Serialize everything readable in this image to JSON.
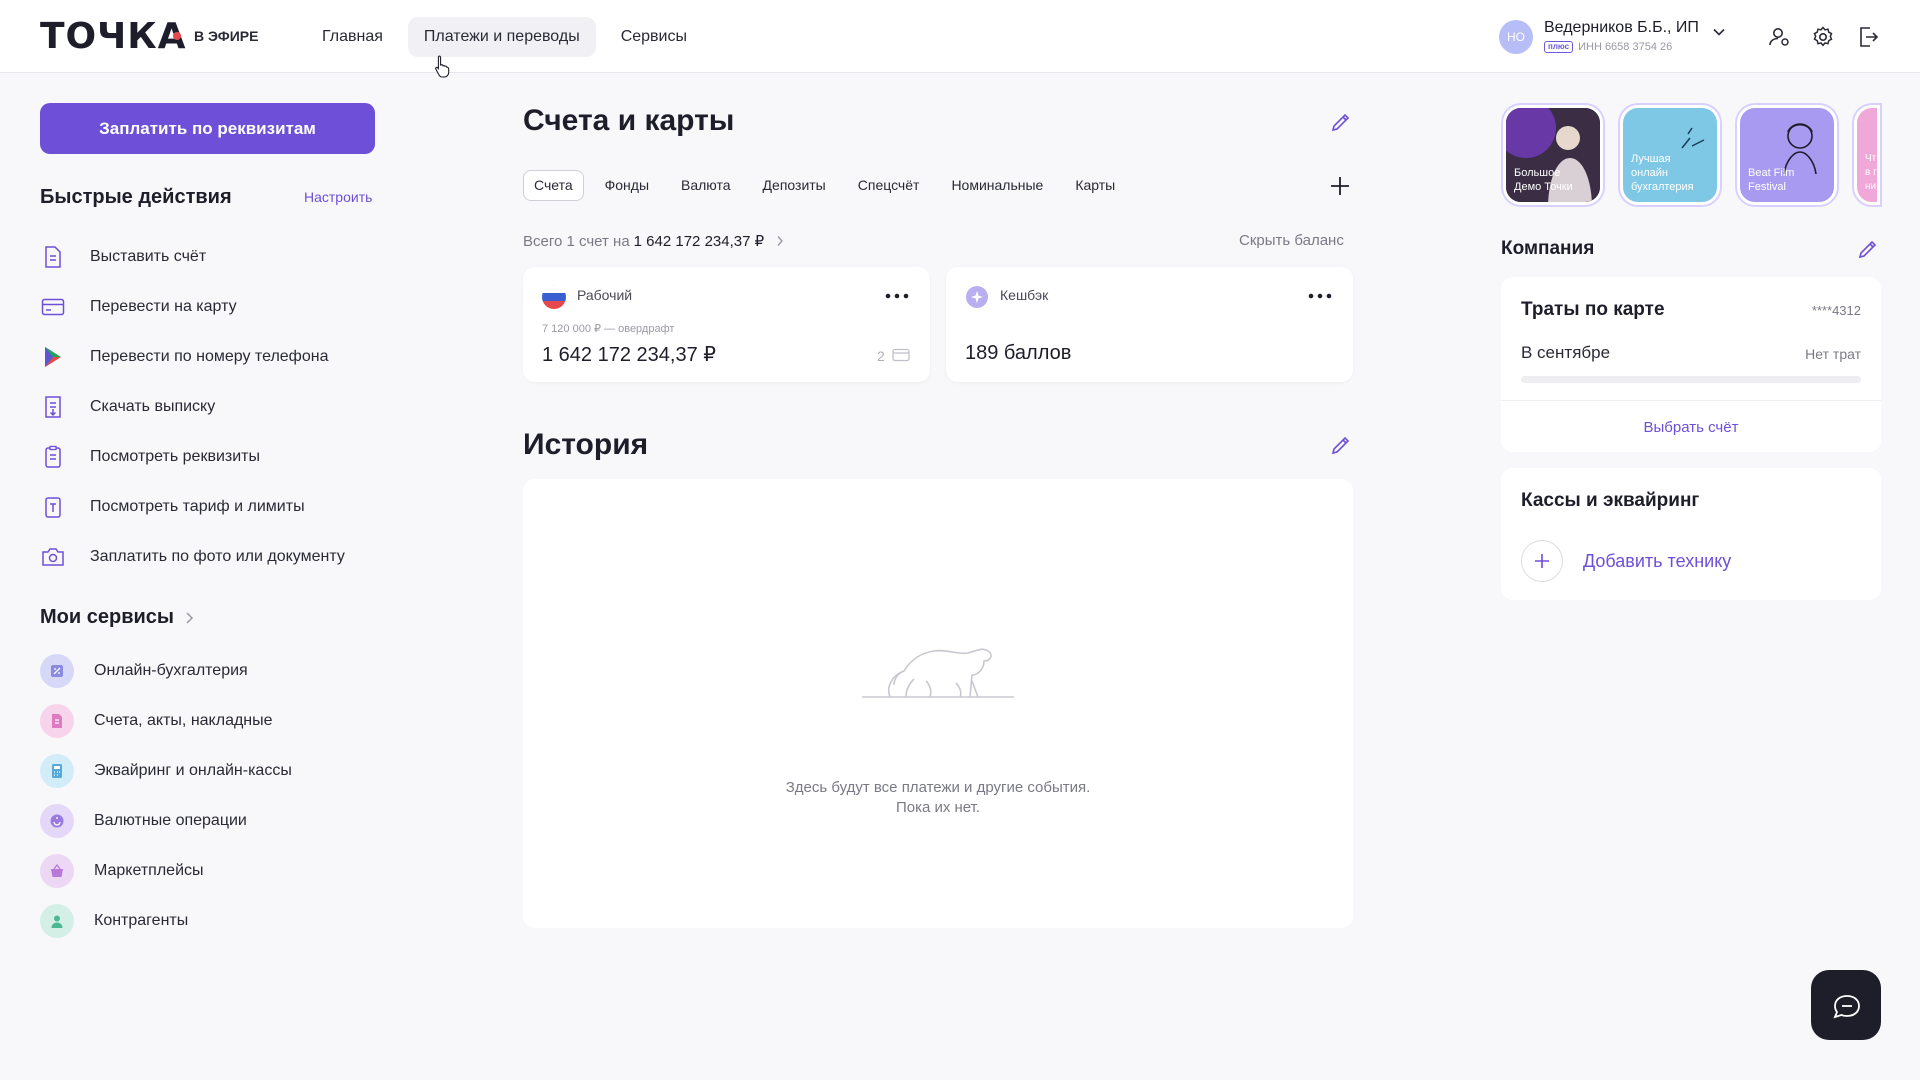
{
  "header": {
    "logo": "ТОЧКА",
    "live": "В ЭФИРЕ",
    "nav": [
      {
        "label": "Главная",
        "active": false
      },
      {
        "label": "Платежи и переводы",
        "active": true
      },
      {
        "label": "Сервисы",
        "active": false
      }
    ],
    "user": {
      "initials": "НО",
      "name": "Ведерников Б.Б., ИП",
      "badge": "плюс",
      "inn": "ИНН 6658 3754 26"
    }
  },
  "left": {
    "pay_button": "Заплатить по реквизитам",
    "quick_title": "Быстрые действия",
    "quick_setup": "Настроить",
    "quick_actions": [
      {
        "label": "Выставить счёт",
        "icon": "invoice-icon"
      },
      {
        "label": "Перевести на карту",
        "icon": "card-icon"
      },
      {
        "label": "Перевести по номеру телефона",
        "icon": "sbp-icon"
      },
      {
        "label": "Скачать выписку",
        "icon": "download-statement-icon"
      },
      {
        "label": "Посмотреть реквизиты",
        "icon": "requisites-icon"
      },
      {
        "label": "Посмотреть тариф и лимиты",
        "icon": "tariff-icon"
      },
      {
        "label": "Заплатить по фото или документу",
        "icon": "camera-icon"
      }
    ],
    "services_title": "Мои сервисы",
    "services": [
      {
        "label": "Онлайн-бухгалтерия",
        "color": "#b8b8f0"
      },
      {
        "label": "Счета, акты, накладные",
        "color": "#f0a8d8"
      },
      {
        "label": "Эквайринг и онлайн-кассы",
        "color": "#a8d8f0"
      },
      {
        "label": "Валютные операции",
        "color": "#c8b0f0"
      },
      {
        "label": "Маркетплейсы",
        "color": "#d8b0e8"
      },
      {
        "label": "Контрагенты",
        "color": "#a8e0d0"
      }
    ]
  },
  "main": {
    "accounts_title": "Счета и карты",
    "tabs": [
      {
        "label": "Счета",
        "active": true
      },
      {
        "label": "Фонды",
        "active": false
      },
      {
        "label": "Валюта",
        "active": false
      },
      {
        "label": "Депозиты",
        "active": false
      },
      {
        "label": "Спецсчёт",
        "active": false
      },
      {
        "label": "Номинальные",
        "active": false
      },
      {
        "label": "Карты",
        "active": false
      }
    ],
    "total_prefix": "Всего 1 счет на",
    "total_amount": "1 642 172 234,37 ₽",
    "hide_balance": "Скрыть баланс",
    "account": {
      "name": "Рабочий",
      "overdraft": "7 120 000 ₽ — овердрафт",
      "balance": "1 642 172 234,37 ₽",
      "cards_count": "2"
    },
    "cashback": {
      "name": "Кешбэк",
      "points": "189 баллов"
    },
    "history_title": "История",
    "history_empty_1": "Здесь будут все платежи и другие события.",
    "history_empty_2": "Пока их нет."
  },
  "right": {
    "stories": [
      {
        "title_1": "Большое",
        "title_2": "Демо Точки",
        "title_3": "",
        "color": "#2b2233"
      },
      {
        "title_1": "Лучшая",
        "title_2": "онлайн",
        "title_3": "бухгалтерия",
        "color": "#7ec8e6"
      },
      {
        "title_1": "Beat Film",
        "title_2": "Festival",
        "title_3": "",
        "color": "#a89af0"
      },
      {
        "title_1": "Чт",
        "title_2": "в г",
        "title_3": "ни",
        "color": "#f0a8d8"
      }
    ],
    "company_title": "Компания",
    "spending": {
      "title": "Траты по карте",
      "card_mask": "****4312",
      "month": "В сентябре",
      "status": "Нет трат",
      "choose": "Выбрать счёт"
    },
    "pos": {
      "title": "Кассы и эквайринг",
      "add": "Добавить технику"
    }
  },
  "colors": {
    "accent": "#6e4fd8"
  }
}
